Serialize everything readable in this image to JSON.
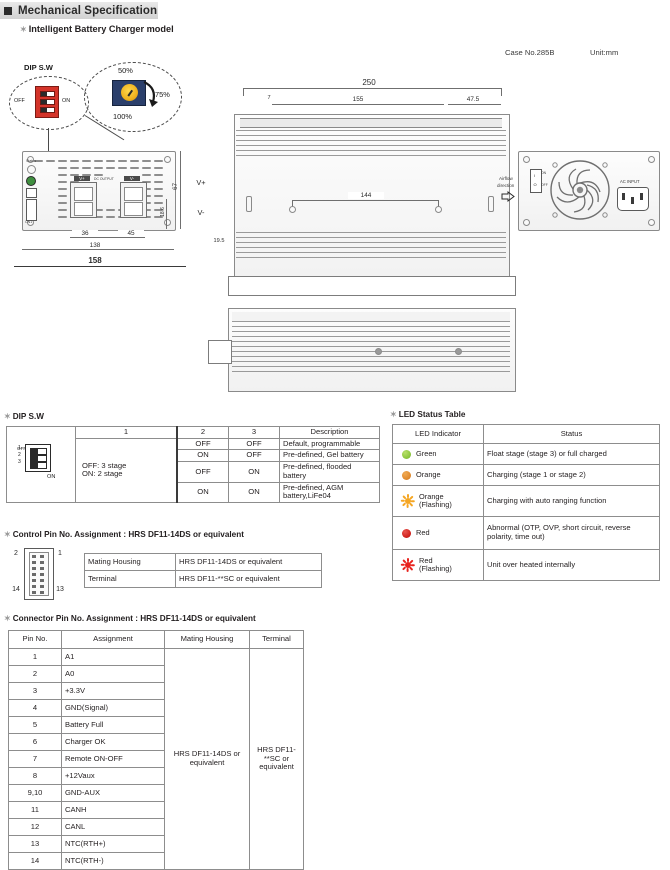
{
  "header": {
    "title": "Mechanical Specification",
    "subtitle": "Intelligent Battery Charger model",
    "case_no": "Case No.285B",
    "unit": "Unit:mm"
  },
  "drawing": {
    "dip_callout_title": "DIP S.W",
    "dip_off": "OFF",
    "dip_on": "ON",
    "dip_pins": [
      "1",
      "2",
      "3"
    ],
    "pot_50": "50%",
    "pot_75": "75%",
    "pot_100": "100%",
    "airflow_line1": "Airflow",
    "airflow_line2": "direction",
    "ac_input": "AC INPUT",
    "dc_output": "DC OUTPUT",
    "status_label": "Status",
    "cn1_label": "CN1",
    "vpos": "V+",
    "vneg": "V-",
    "sw_on": "ON",
    "sw_off": "OFF",
    "dimensions": {
      "total_length": "250",
      "len_155": "155",
      "len_47_5": "47.5",
      "len_7": "7",
      "holes_144": "144",
      "height_67": "67",
      "h_18_6": "18.6",
      "w_36": "36",
      "w_45": "45",
      "w_138": "138",
      "w_158": "158",
      "d_19_5": "19.5"
    }
  },
  "dip_table": {
    "title": "DIP S.W",
    "legend_off": "OFF: 3 stage",
    "legend_on": "ON:  2 stage",
    "headers": [
      "",
      "1",
      "2",
      "3",
      "Description"
    ],
    "rows": [
      {
        "sw2": "OFF",
        "sw3": "OFF",
        "desc": "Default, programmable"
      },
      {
        "sw2": "ON",
        "sw3": "OFF",
        "desc": "Pre-defined, Gel battery"
      },
      {
        "sw2": "OFF",
        "sw3": "ON",
        "desc": "Pre-defined, flooded battery"
      },
      {
        "sw2": "ON",
        "sw3": "ON",
        "desc": "Pre-defined, AGM battery,LiFe04"
      }
    ]
  },
  "led_table": {
    "title": "LED Status Table",
    "headers": [
      "LED Indicator",
      "Status"
    ],
    "rows": [
      {
        "led": "Green",
        "sub": "",
        "color": "#8CC63E",
        "flashing": false,
        "status": "Float stage (stage 3) or full charged"
      },
      {
        "led": "Orange",
        "sub": "",
        "color": "#E08A2E",
        "flashing": false,
        "status": "Charging (stage 1 or stage 2)"
      },
      {
        "led": "Orange",
        "sub": "(Flashing)",
        "color": "#F5A623",
        "flashing": true,
        "status": "Charging with auto ranging function"
      },
      {
        "led": "Red",
        "sub": "",
        "color": "#D0211C",
        "flashing": false,
        "status": "Abnormal (OTP, OVP, short circuit, reverse polarity, time out)"
      },
      {
        "led": "Red",
        "sub": "(Flashing)",
        "color": "#E8231E",
        "flashing": true,
        "status": "Unit over heated internally"
      }
    ]
  },
  "control_pin": {
    "title": "Control Pin No. Assignment : HRS DF11-14DS or equivalent",
    "pin_labels": {
      "tl": "2",
      "tr": "1",
      "bl": "14",
      "br": "13"
    },
    "rows": [
      {
        "name": "Mating Housing",
        "value": "HRS DF11-14DS or equivalent"
      },
      {
        "name": "Terminal",
        "value": "HRS DF11-**SC or equivalent"
      }
    ]
  },
  "connector_pin": {
    "title": "Connector Pin No. Assignment : HRS DF11-14DS or equivalent",
    "headers": [
      "Pin No.",
      "Assignment",
      "Mating Housing",
      "Terminal"
    ],
    "mating_housing": "HRS DF11-14DS or equivalent",
    "terminal": "HRS DF11-**SC or equivalent",
    "rows": [
      {
        "pin": "1",
        "assignment": "A1"
      },
      {
        "pin": "2",
        "assignment": "A0"
      },
      {
        "pin": "3",
        "assignment": "+3.3V"
      },
      {
        "pin": "4",
        "assignment": "GND(Signal)"
      },
      {
        "pin": "5",
        "assignment": "Battery Full"
      },
      {
        "pin": "6",
        "assignment": "Charger OK"
      },
      {
        "pin": "7",
        "assignment": "Remote ON-OFF"
      },
      {
        "pin": "8",
        "assignment": "+12Vaux"
      },
      {
        "pin": "9,10",
        "assignment": "GND-AUX"
      },
      {
        "pin": "11",
        "assignment": "CANH"
      },
      {
        "pin": "12",
        "assignment": "CANL"
      },
      {
        "pin": "13",
        "assignment": "NTC(RTH+)"
      },
      {
        "pin": "14",
        "assignment": "NTC(RTH-)"
      }
    ]
  }
}
